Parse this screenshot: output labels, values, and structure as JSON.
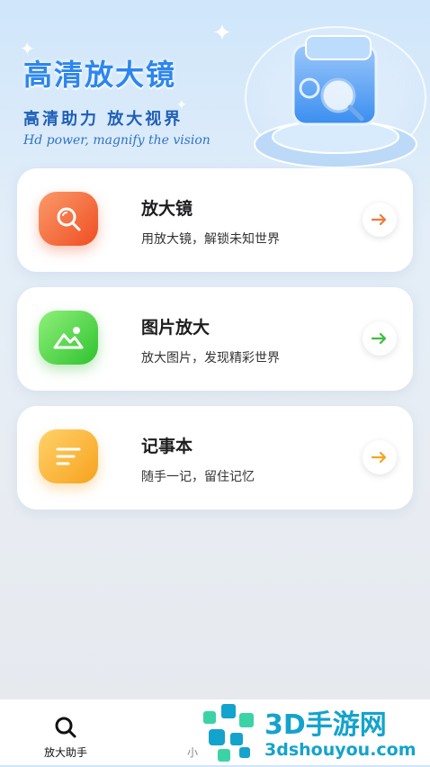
{
  "header": {
    "title": "高清放大镜",
    "slogan": "高清助力 放大视界",
    "subtitle": "Hd power, magnify the vision"
  },
  "cards": [
    {
      "title": "放大镜",
      "desc": "用放大镜，解锁未知世界",
      "icon": "magnifier-icon",
      "color": "#f36b3f",
      "arrow_color": "#f07a3a"
    },
    {
      "title": "图片放大",
      "desc": "放大图片，发现精彩世界",
      "icon": "image-icon",
      "color": "#4fd24a",
      "arrow_color": "#3cbf3a"
    },
    {
      "title": "记事本",
      "desc": "随手一记，留住记忆",
      "icon": "notes-icon",
      "color": "#fbb431",
      "arrow_color": "#f3a51f"
    }
  ],
  "bottom_nav": {
    "items": [
      {
        "label": "放大助手",
        "icon": "search-icon"
      },
      {
        "label": "小",
        "icon": ""
      }
    ]
  },
  "watermark": {
    "line1": "3D手游网",
    "line2": "3dshouyou.com"
  }
}
